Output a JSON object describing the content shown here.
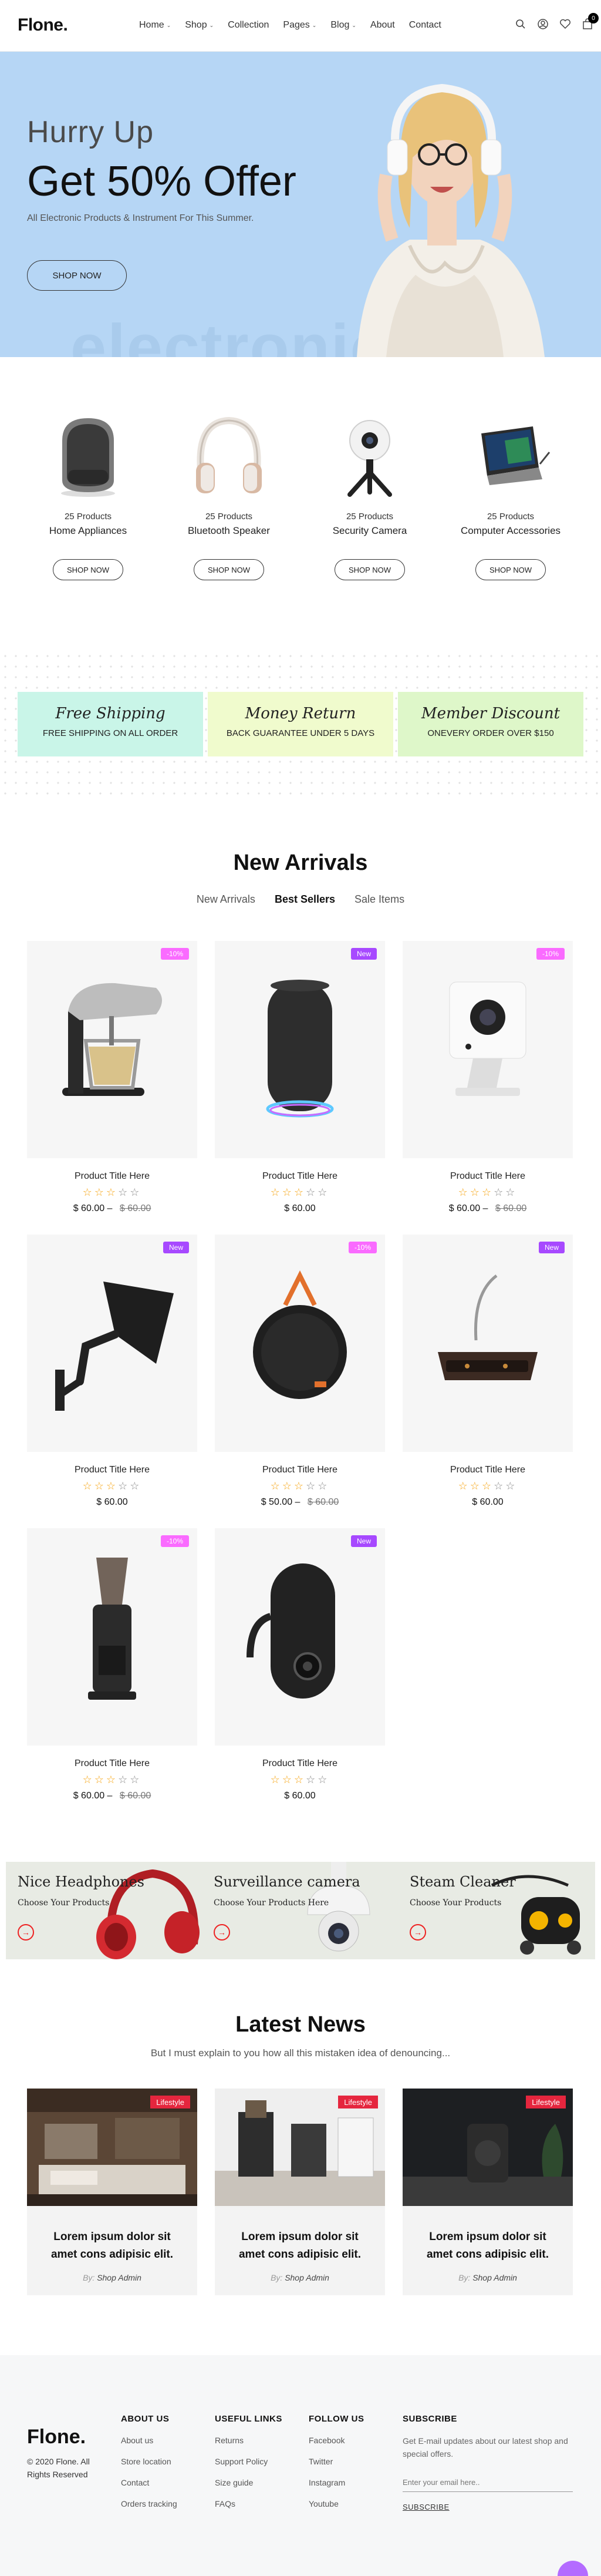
{
  "header": {
    "logo": "Flone.",
    "nav": [
      {
        "label": "Home",
        "dropdown": true
      },
      {
        "label": "Shop",
        "dropdown": true
      },
      {
        "label": "Collection",
        "dropdown": false
      },
      {
        "label": "Pages",
        "dropdown": true
      },
      {
        "label": "Blog",
        "dropdown": true
      },
      {
        "label": "About",
        "dropdown": false
      },
      {
        "label": "Contact",
        "dropdown": false
      }
    ],
    "icons": [
      "search-icon",
      "user-icon",
      "heart-icon",
      "cart-icon"
    ],
    "cart_count": "0",
    "caret": "⌄"
  },
  "hero": {
    "kicker": "Hurry Up",
    "title": "Get 50% Offer",
    "subtitle": "All Electronic Products & Instrument For This Summer.",
    "button": "SHOP NOW",
    "watermark": "electronic"
  },
  "categories": [
    {
      "count": "25 Products",
      "name": "Home Appliances",
      "button": "SHOP NOW"
    },
    {
      "count": "25 Products",
      "name": "Bluetooth Speaker",
      "button": "SHOP NOW"
    },
    {
      "count": "25 Products",
      "name": "Security Camera",
      "button": "SHOP NOW"
    },
    {
      "count": "25 Products",
      "name": "Computer Accessories",
      "button": "SHOP NOW"
    }
  ],
  "features": [
    {
      "title": "Free Shipping",
      "subtitle": "FREE SHIPPING ON ALL ORDER",
      "color": "#c9f5e8"
    },
    {
      "title": "Money Return",
      "subtitle": "BACK GUARANTEE UNDER 5 DAYS",
      "color": "#f0fbcd"
    },
    {
      "title": "Member Discount",
      "subtitle": "ONEVERY ORDER OVER $150",
      "color": "#def7c9"
    }
  ],
  "new_arrivals": {
    "title": "New Arrivals",
    "tabs": [
      "New Arrivals",
      "Best Sellers",
      "Sale Items"
    ],
    "active_tab": "Best Sellers",
    "products": [
      {
        "name": "Product Title Here",
        "badge": "-10%",
        "badge_type": "sale",
        "rating": 3,
        "price": "$ 60.00",
        "old_price": "$ 60.00",
        "image": "stand-mixer"
      },
      {
        "name": "Product Title Here",
        "badge": "New",
        "badge_type": "new",
        "rating": 3,
        "price": "$ 60.00",
        "old_price": "",
        "image": "cylinder-speaker"
      },
      {
        "name": "Product Title Here",
        "badge": "-10%",
        "badge_type": "sale",
        "rating": 3,
        "price": "$ 60.00",
        "old_price": "$ 60.00",
        "image": "security-camera"
      },
      {
        "name": "Product Title Here",
        "badge": "New",
        "badge_type": "new",
        "rating": 3,
        "price": "$ 60.00",
        "old_price": "",
        "image": "monitor-arm"
      },
      {
        "name": "Product Title Here",
        "badge": "-10%",
        "badge_type": "sale",
        "rating": 3,
        "price": "$ 50.00",
        "old_price": "$ 60.00",
        "image": "round-speaker"
      },
      {
        "name": "Product Title Here",
        "badge": "New",
        "badge_type": "new",
        "rating": 3,
        "price": "$ 60.00",
        "old_price": "",
        "image": "desk-lamp"
      },
      {
        "name": "Product Title Here",
        "badge": "-10%",
        "badge_type": "sale",
        "rating": 3,
        "price": "$ 60.00",
        "old_price": "$ 60.00",
        "image": "coffee-grinder"
      },
      {
        "name": "Product Title Here",
        "badge": "New",
        "badge_type": "new",
        "rating": 3,
        "price": "$ 60.00",
        "old_price": "",
        "image": "indoor-camera"
      }
    ]
  },
  "banners": [
    {
      "title": "Nice Headphones",
      "subtitle": "Choose Your Products",
      "image": "red-headphones"
    },
    {
      "title": "Surveillance camera",
      "subtitle": "Choose Your Products Here",
      "image": "dome-camera"
    },
    {
      "title": "Steam Cleaner",
      "subtitle": "Choose Your Products",
      "image": "steam-cleaner"
    }
  ],
  "news": {
    "title": "Latest News",
    "subtitle": "But I must explain to you how all this mistaken idea of denouncing...",
    "by_label": "By:",
    "posts": [
      {
        "tag": "Lifestyle",
        "title": "Lorem ipsum dolor sit amet cons adipisic elit.",
        "author": "Shop Admin"
      },
      {
        "tag": "Lifestyle",
        "title": "Lorem ipsum dolor sit amet cons adipisic elit.",
        "author": "Shop Admin"
      },
      {
        "tag": "Lifestyle",
        "title": "Lorem ipsum dolor sit amet cons adipisic elit.",
        "author": "Shop Admin"
      }
    ]
  },
  "footer": {
    "logo": "Flone.",
    "copyright": "© 2020 Flone. All Rights Reserved",
    "columns": [
      {
        "heading": "ABOUT US",
        "items": [
          "About us",
          "Store location",
          "Contact",
          "Orders tracking"
        ]
      },
      {
        "heading": "USEFUL LINKS",
        "items": [
          "Returns",
          "Support Policy",
          "Size guide",
          "FAQs"
        ]
      },
      {
        "heading": "FOLLOW US",
        "items": [
          "Facebook",
          "Twitter",
          "Instagram",
          "Youtube"
        ]
      }
    ],
    "subscribe": {
      "heading": "SUBSCRIBE",
      "description": "Get E-mail updates about our latest shop and special offers.",
      "placeholder": "Enter your email here..",
      "button": "SUBSCRIBE"
    }
  }
}
